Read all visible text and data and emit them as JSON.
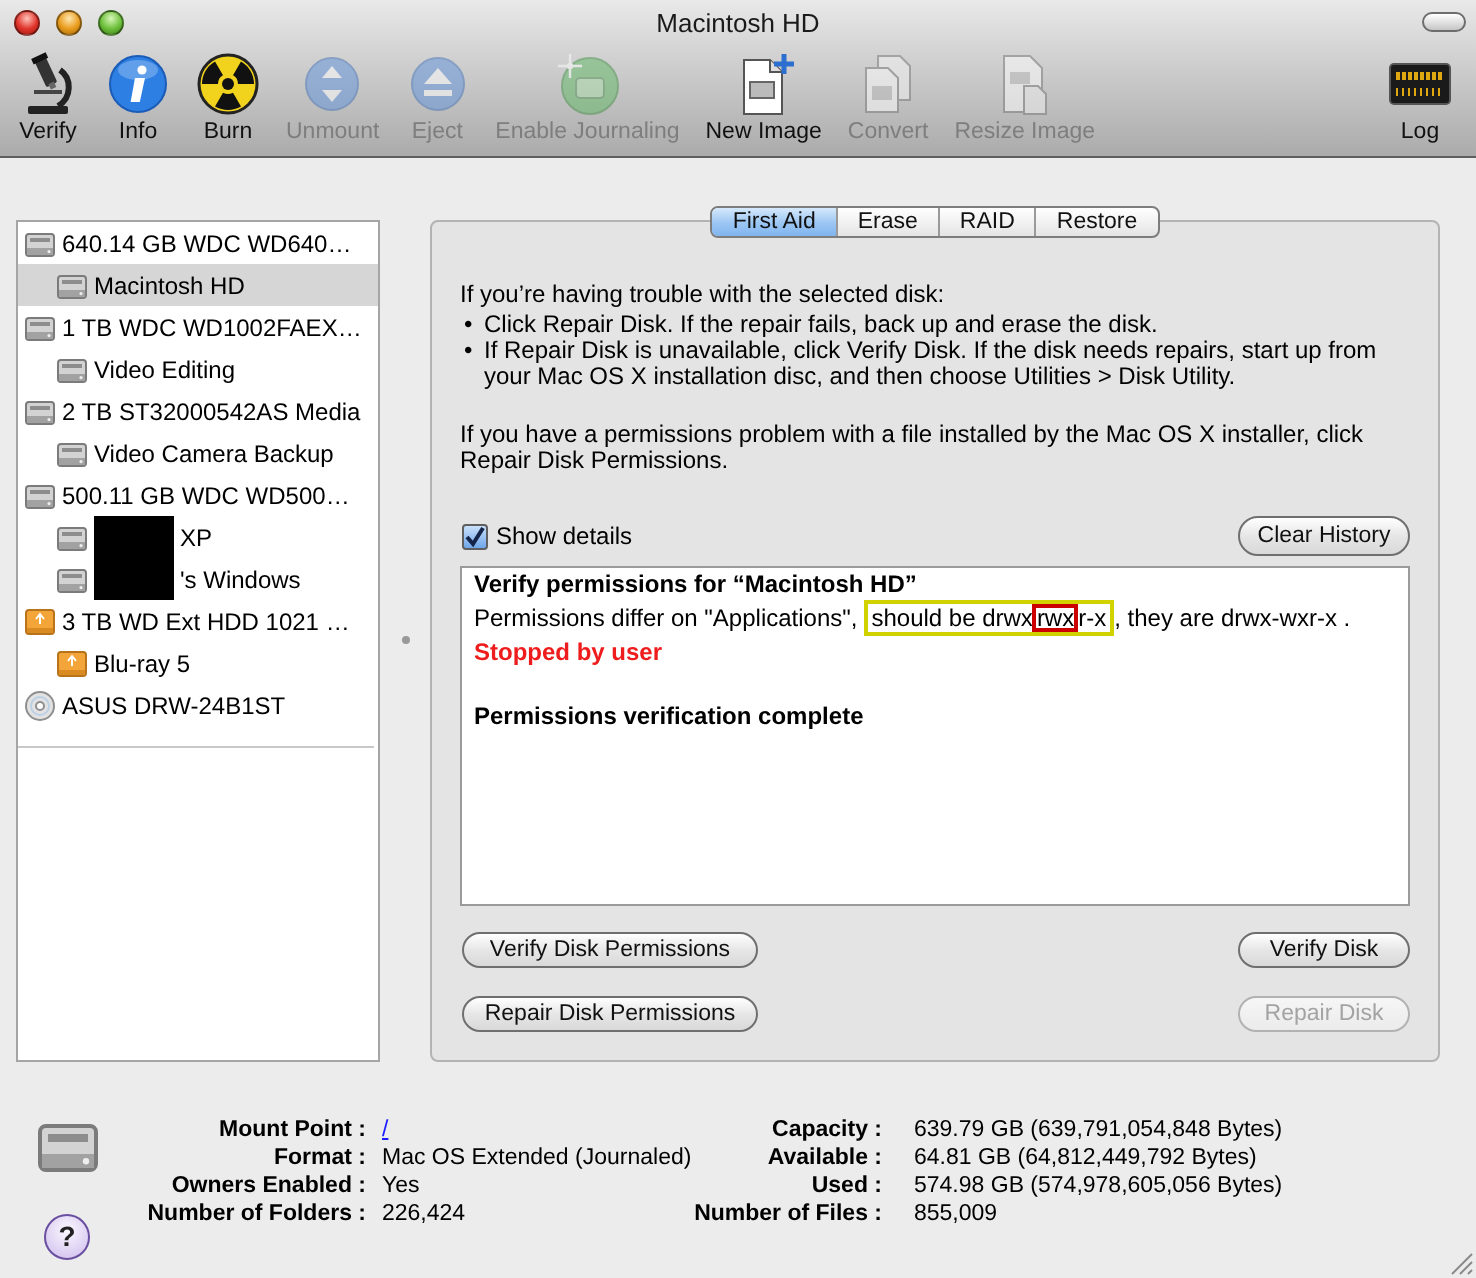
{
  "window": {
    "title": "Macintosh HD"
  },
  "toolbar": [
    {
      "kind": "verify",
      "label": "Verify",
      "disabled": false
    },
    {
      "kind": "info",
      "label": "Info",
      "disabled": false
    },
    {
      "kind": "burn",
      "label": "Burn",
      "disabled": false
    },
    {
      "kind": "unmount",
      "label": "Unmount",
      "disabled": true
    },
    {
      "kind": "eject",
      "label": "Eject",
      "disabled": true
    },
    {
      "kind": "journaling",
      "label": "Enable Journaling",
      "disabled": true
    },
    {
      "kind": "new_image",
      "label": "New Image",
      "disabled": false
    },
    {
      "kind": "convert",
      "label": "Convert",
      "disabled": true
    },
    {
      "kind": "resize",
      "label": "Resize Image",
      "disabled": true
    },
    {
      "kind": "log",
      "label": "Log",
      "disabled": false
    }
  ],
  "sidebar": {
    "items": [
      {
        "kind": "internal",
        "label": "640.14 GB WDC WD640…",
        "selected": false,
        "children": [
          {
            "kind": "internal",
            "label": "Macintosh HD",
            "selected": true
          }
        ]
      },
      {
        "kind": "internal",
        "label": "1 TB WDC WD1002FAEX…",
        "selected": false,
        "children": [
          {
            "kind": "internal",
            "label": "Video Editing",
            "selected": false
          }
        ]
      },
      {
        "kind": "internal",
        "label": "2 TB ST32000542AS Media",
        "selected": false,
        "children": [
          {
            "kind": "internal",
            "label": "Video Camera Backup",
            "selected": false
          }
        ]
      },
      {
        "kind": "internal",
        "label": "500.11 GB WDC WD500…",
        "selected": false,
        "children": [
          {
            "kind": "internal",
            "label": "XP",
            "selected": false,
            "redacted": true
          },
          {
            "kind": "internal",
            "label": "'s Windows",
            "selected": false,
            "redacted": true
          }
        ]
      },
      {
        "kind": "external",
        "label": "3 TB WD Ext HDD 1021 …",
        "selected": false,
        "children": [
          {
            "kind": "external",
            "label": "Blu-ray 5",
            "selected": false
          }
        ]
      },
      {
        "kind": "optical",
        "label": "ASUS DRW-24B1ST",
        "selected": false
      }
    ]
  },
  "panel": {
    "tabs": [
      {
        "label": "First Aid",
        "selected": true
      },
      {
        "label": "Erase",
        "selected": false
      },
      {
        "label": "RAID",
        "selected": false
      },
      {
        "label": "Restore",
        "selected": false
      }
    ],
    "intro": "If you’re having trouble with the selected disk:",
    "bullets": [
      {
        "marker": "•",
        "text": "Click Repair Disk. If the repair fails, back up and erase the disk."
      },
      {
        "marker": "•",
        "text": "If Repair Disk is unavailable, click Verify Disk. If the disk needs repairs, start up from your Mac OS X installation disc, and then choose Utilities > Disk Utility."
      }
    ],
    "permissions_note": "If you have a permissions problem with a file installed by the Mac OS X installer, click Repair Disk Permissions.",
    "show_details": {
      "label": "Show details",
      "checked": true
    },
    "clear_history_button": "Clear History",
    "log": [
      {
        "kind": "heading",
        "text": "Verify permissions for “Macintosh HD”"
      },
      {
        "kind": "annotated",
        "parts": [
          {
            "text": "Permissions differ on \"Applications\","
          },
          {
            "color": "#d2d200",
            "parts": [
              {
                "text": "should be drwx"
              },
              {
                "color": "#cc0000",
                "text": "rwx"
              },
              {
                "text": "r-x"
              }
            ]
          },
          {
            "text": ", they are drwx-wxr-x ."
          }
        ]
      },
      {
        "kind": "error",
        "text": "Stopped by user"
      },
      {
        "kind": "summary",
        "text": "Permissions verification complete"
      }
    ],
    "buttons": [
      {
        "label": "Verify Disk Permissions",
        "disabled": false
      },
      {
        "label": "Verify Disk",
        "disabled": false
      },
      {
        "label": "Repair Disk Permissions",
        "disabled": false
      },
      {
        "label": "Repair Disk",
        "disabled": true
      }
    ]
  },
  "info": {
    "left": [
      {
        "label": "Mount Point :",
        "value": "/",
        "kind": "link"
      },
      {
        "label": "Format :",
        "value": "Mac OS Extended (Journaled)",
        "kind": "text"
      },
      {
        "label": "Owners Enabled :",
        "value": "Yes",
        "kind": "text"
      },
      {
        "label": "Number of Folders :",
        "value": "226,424",
        "kind": "text"
      }
    ],
    "right": [
      {
        "label": "Capacity :",
        "value": "639.79 GB (639,791,054,848 Bytes)",
        "kind": "text"
      },
      {
        "label": "Available :",
        "value": "64.81 GB (64,812,449,792 Bytes)",
        "kind": "text"
      },
      {
        "label": "Used :",
        "value": "574.98 GB (574,978,605,056 Bytes)",
        "kind": "text"
      },
      {
        "label": "Number of Files :",
        "value": "855,009",
        "kind": "text"
      }
    ]
  },
  "help_button": "?"
}
